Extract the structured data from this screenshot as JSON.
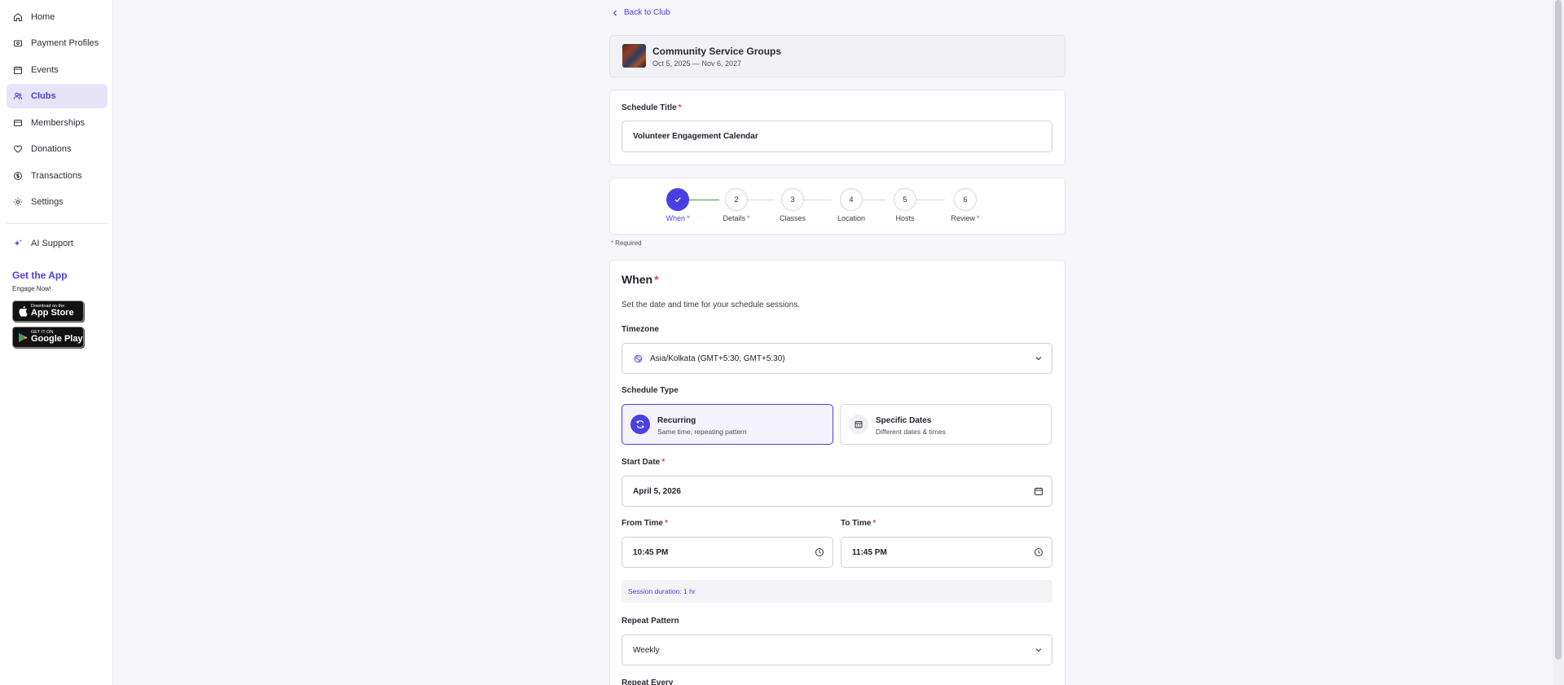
{
  "sidebar": {
    "items": [
      {
        "label": "Home",
        "icon": "home-icon"
      },
      {
        "label": "Payment Profiles",
        "icon": "payment-icon"
      },
      {
        "label": "Events",
        "icon": "calendar-icon"
      },
      {
        "label": "Clubs",
        "icon": "users-icon",
        "active": true
      },
      {
        "label": "Memberships",
        "icon": "card-icon"
      },
      {
        "label": "Donations",
        "icon": "heart-icon"
      },
      {
        "label": "Transactions",
        "icon": "dollar-icon"
      },
      {
        "label": "Settings",
        "icon": "gear-icon"
      }
    ],
    "ai_support": "AI Support",
    "get_app_title": "Get the App",
    "get_app_sub": "Engage Now!",
    "app_store_small": "Download on the",
    "app_store_big": "App Store",
    "google_play_small": "GET IT ON",
    "google_play_big": "Google Play"
  },
  "back_link": "Back to Club",
  "club": {
    "name": "Community Service Groups",
    "dates": "Oct 5, 2025 — Nov 6, 2027"
  },
  "schedule_title": {
    "label": "Schedule Title",
    "value": "Volunteer Engagement Calendar"
  },
  "stepper": {
    "steps": [
      {
        "number": "✓",
        "label": "When"
      },
      {
        "number": "2",
        "label": "Details"
      },
      {
        "number": "3",
        "label": "Classes"
      },
      {
        "number": "4",
        "label": "Location"
      },
      {
        "number": "5",
        "label": "Hosts"
      },
      {
        "number": "6",
        "label": "Review"
      }
    ]
  },
  "required_note": "Required",
  "when": {
    "title": "When",
    "description": "Set the date and time for your schedule sessions.",
    "timezone_label": "Timezone",
    "timezone_value": "Asia/Kolkata (GMT+5:30, GMT+5:30)",
    "schedule_type_label": "Schedule Type",
    "recurring_title": "Recurring",
    "recurring_sub": "Same time, repeating pattern",
    "specific_title": "Specific Dates",
    "specific_sub": "Different dates & times",
    "start_date_label": "Start Date",
    "start_date_value": "April 5, 2026",
    "from_time_label": "From Time",
    "from_time_value": "10:45 PM",
    "to_time_label": "To Time",
    "to_time_value": "11:45 PM",
    "duration": "Session duration: 1 hr",
    "repeat_pattern_label": "Repeat Pattern",
    "repeat_pattern_value": "Weekly",
    "repeat_every_label": "Repeat Every"
  },
  "colors": {
    "accent": "#4a3fe0",
    "required": "#e0404a",
    "step_done_line": "#3a9a55"
  }
}
